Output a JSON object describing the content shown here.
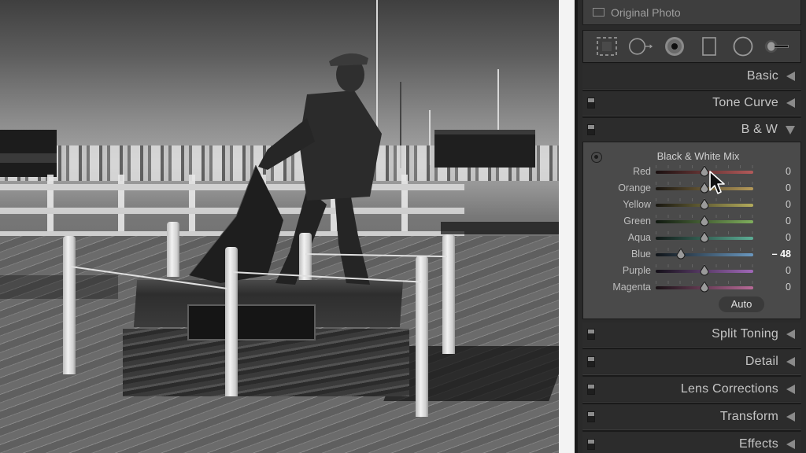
{
  "photo": {
    "description": "Black and white photograph of a fisherman statue pulling a net on a wooden pier with harbor boats in background",
    "alt": "fisherman-statue-bw-photo"
  },
  "panel": {
    "original_photo_label": "Original Photo",
    "tools": [
      {
        "name": "crop-overlay-icon"
      },
      {
        "name": "spot-removal-icon"
      },
      {
        "name": "red-eye-icon"
      },
      {
        "name": "graduated-filter-icon"
      },
      {
        "name": "radial-filter-icon"
      },
      {
        "name": "adjustment-brush-icon"
      }
    ],
    "sections_top": [
      {
        "id": "basic",
        "title": "Basic",
        "has_switch": false,
        "expanded": false
      },
      {
        "id": "tone-curve",
        "title": "Tone Curve",
        "has_switch": true,
        "expanded": false
      },
      {
        "id": "bw",
        "title": "B & W",
        "has_switch": true,
        "expanded": true
      }
    ],
    "bw_mix": {
      "title": "Black & White Mix",
      "range": [
        -100,
        100
      ],
      "sliders": [
        {
          "label": "Red",
          "value": 0,
          "display": "0",
          "track": [
            "#1a1010",
            "#b35a5a"
          ]
        },
        {
          "label": "Orange",
          "value": 0,
          "display": "0",
          "track": [
            "#181410",
            "#b59a5a"
          ]
        },
        {
          "label": "Yellow",
          "value": 0,
          "display": "0",
          "track": [
            "#181610",
            "#b4ac5c"
          ]
        },
        {
          "label": "Green",
          "value": 0,
          "display": "0",
          "track": [
            "#101810",
            "#7fae5c"
          ]
        },
        {
          "label": "Aqua",
          "value": 0,
          "display": "0",
          "track": [
            "#101816",
            "#5cae96"
          ]
        },
        {
          "label": "Blue",
          "value": -48,
          "display": "– 48",
          "track": [
            "#101418",
            "#6a98c0"
          ]
        },
        {
          "label": "Purple",
          "value": 0,
          "display": "0",
          "track": [
            "#141018",
            "#a068b8"
          ]
        },
        {
          "label": "Magenta",
          "value": 0,
          "display": "0",
          "track": [
            "#181014",
            "#b86a98"
          ]
        }
      ],
      "auto_label": "Auto"
    },
    "sections_bottom": [
      {
        "id": "split-toning",
        "title": "Split Toning",
        "has_switch": true
      },
      {
        "id": "detail",
        "title": "Detail",
        "has_switch": true
      },
      {
        "id": "lens-corrections",
        "title": "Lens Corrections",
        "has_switch": true
      },
      {
        "id": "transform",
        "title": "Transform",
        "has_switch": true
      },
      {
        "id": "effects",
        "title": "Effects",
        "has_switch": true
      }
    ]
  }
}
